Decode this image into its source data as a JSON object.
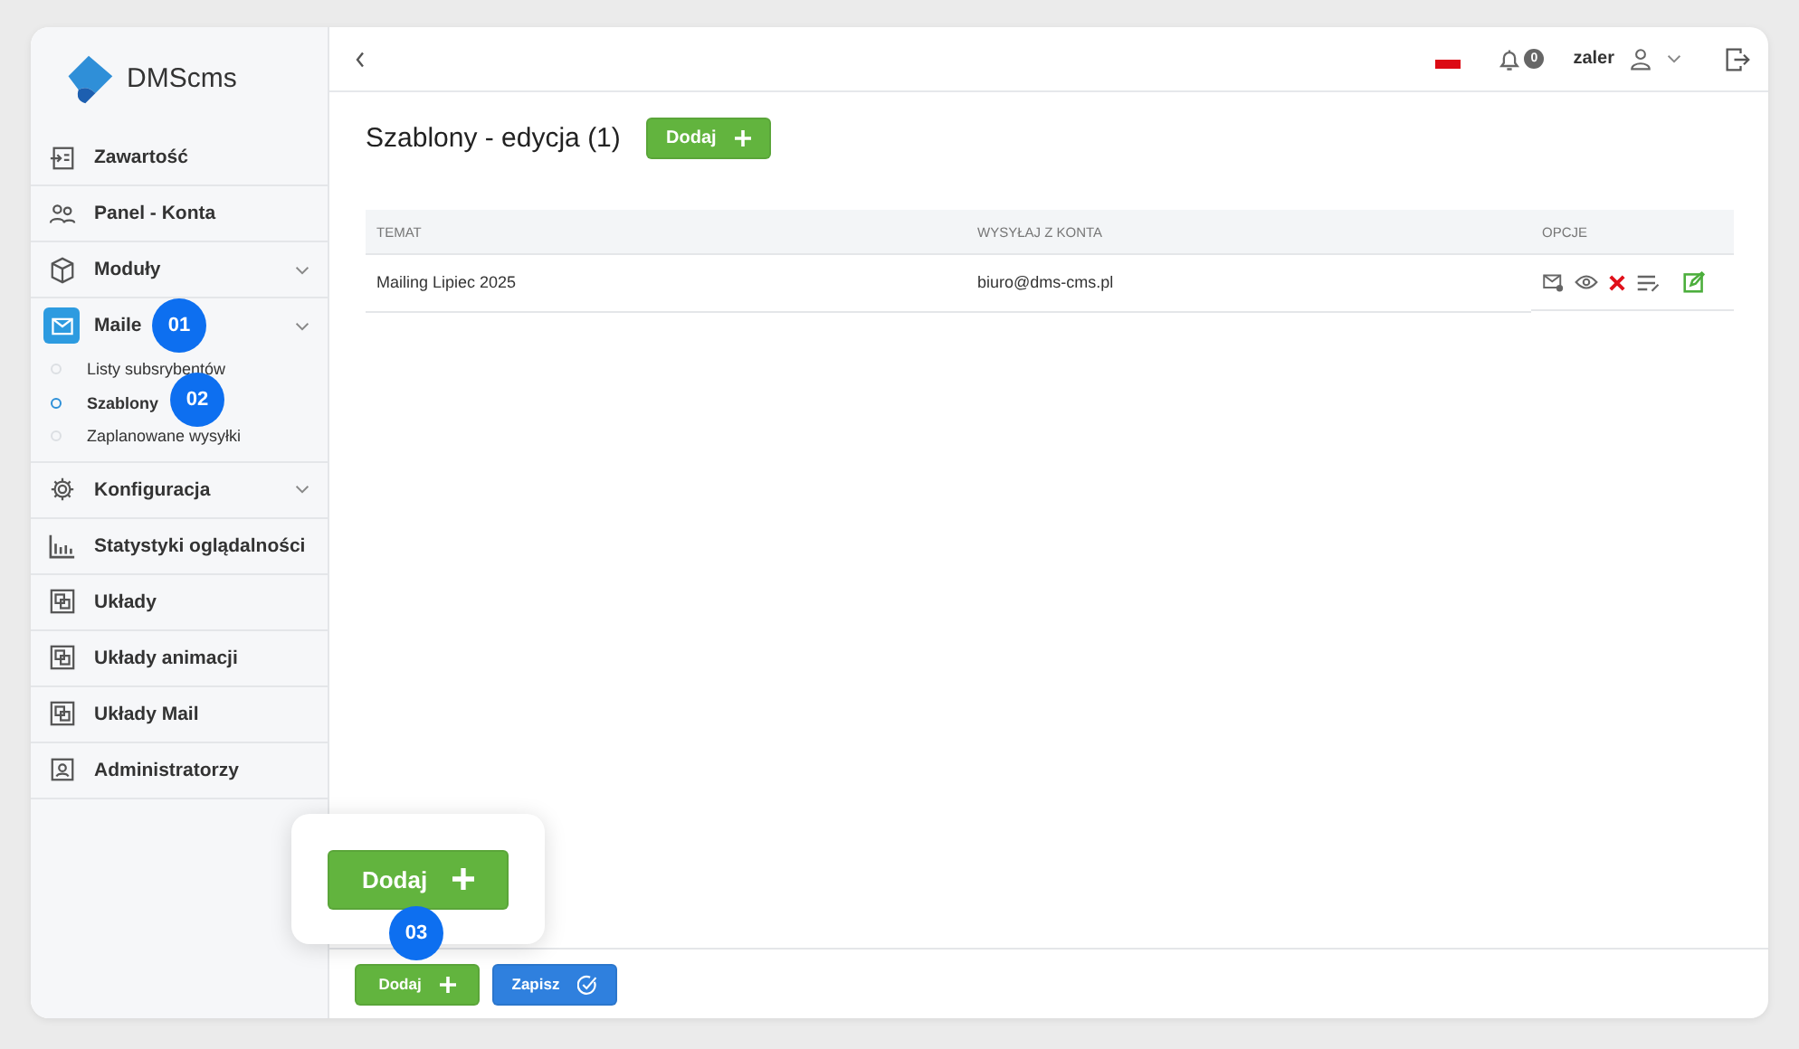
{
  "logo": {
    "text": "DMScms"
  },
  "sidebar": {
    "items": [
      {
        "label": "Zawartość",
        "kind": "content",
        "has_submenu": false,
        "selected": false
      },
      {
        "label": "Panel - Konta",
        "kind": "users",
        "has_submenu": false,
        "selected": false
      },
      {
        "label": "Moduły",
        "kind": "cube",
        "has_submenu": true,
        "selected": false
      },
      {
        "label": "Maile",
        "kind": "mail",
        "has_submenu": true,
        "selected": true,
        "children": [
          {
            "label": "Listy subsrybentów",
            "selected": false
          },
          {
            "label": "Szablony",
            "selected": true
          },
          {
            "label": "Zaplanowane wysyłki",
            "selected": false
          }
        ]
      },
      {
        "label": "Konfiguracja",
        "kind": "gear",
        "has_submenu": true,
        "selected": false
      },
      {
        "label": "Statystyki oglądalności",
        "kind": "chart",
        "has_submenu": false,
        "selected": false
      },
      {
        "label": "Układy",
        "kind": "layout",
        "has_submenu": false,
        "selected": false
      },
      {
        "label": "Układy animacji",
        "kind": "layout",
        "has_submenu": false,
        "selected": false
      },
      {
        "label": "Układy Mail",
        "kind": "layout",
        "has_submenu": false,
        "selected": false
      },
      {
        "label": "Administratorzy",
        "kind": "person",
        "has_submenu": false,
        "selected": false
      }
    ]
  },
  "header": {
    "notifications": "0",
    "user": "zaler"
  },
  "page": {
    "title": "Szablony - edycja (1)",
    "add_button": "Dodaj"
  },
  "table": {
    "columns": [
      "TEMAT",
      "WYSYŁAJ Z KONTA",
      "OPCJE"
    ],
    "rows": [
      {
        "cells": [
          "Mailing Lipiec 2025",
          "biuro@dms-cms.pl"
        ]
      }
    ]
  },
  "footer": {
    "buttons": [
      {
        "label": "Dodaj",
        "kind": "add"
      },
      {
        "label": "Zapisz",
        "kind": "save"
      }
    ]
  },
  "zoom_popup": {
    "button": "Dodaj"
  },
  "callouts": [
    {
      "label": "01"
    },
    {
      "label": "02"
    },
    {
      "label": "03"
    }
  ]
}
